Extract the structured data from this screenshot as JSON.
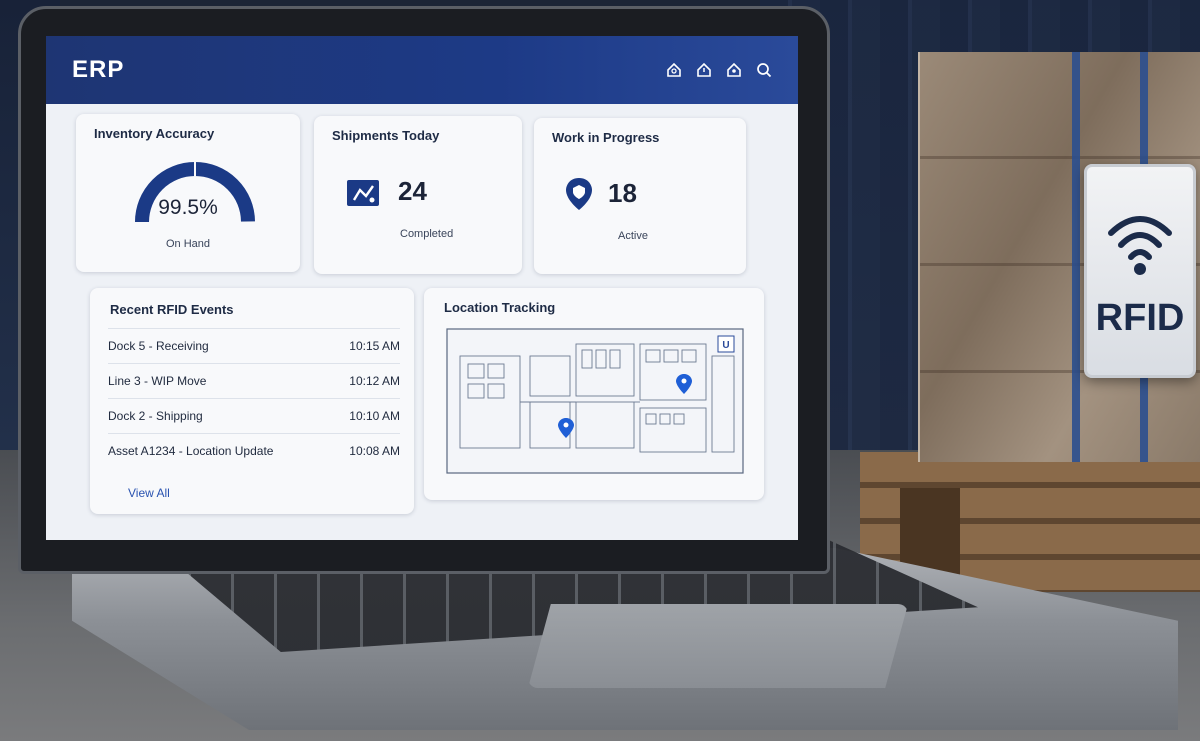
{
  "app": {
    "title": "ERP"
  },
  "header_icons": [
    "home-icon",
    "home-alert-icon",
    "home-user-icon",
    "search-icon"
  ],
  "inventory_accuracy": {
    "title": "Inventory Accuracy",
    "value": "99.5%",
    "label": "On Hand",
    "level_percent": 99.5
  },
  "shipments": {
    "title": "Shipments Today",
    "value": "24",
    "label": "Completed",
    "icon": "map-icon"
  },
  "work_in_progress": {
    "title": "Work in Progress",
    "value": "18",
    "label": "Active",
    "icon": "location-shield-icon"
  },
  "rfid_events": {
    "title": "Recent RFID Events",
    "rows": [
      {
        "event": "Dock 5 - Receiving",
        "time": "10:15 AM"
      },
      {
        "event": "Line 3 - WIP Move",
        "time": "10:12 AM"
      },
      {
        "event": "Dock 2 - Shipping",
        "time": "10:10 AM"
      },
      {
        "event": "Asset A1234 - Location Update",
        "time": "10:08 AM"
      }
    ],
    "view_all": "View All"
  },
  "location_tracking": {
    "title": "Location Tracking",
    "markers": 2
  },
  "rfid_tag": {
    "label": "RFID"
  },
  "colors": {
    "header": "#1e3573",
    "accent": "#1d3a86",
    "link": "#2a53b0",
    "marker": "#1f5fd6"
  }
}
